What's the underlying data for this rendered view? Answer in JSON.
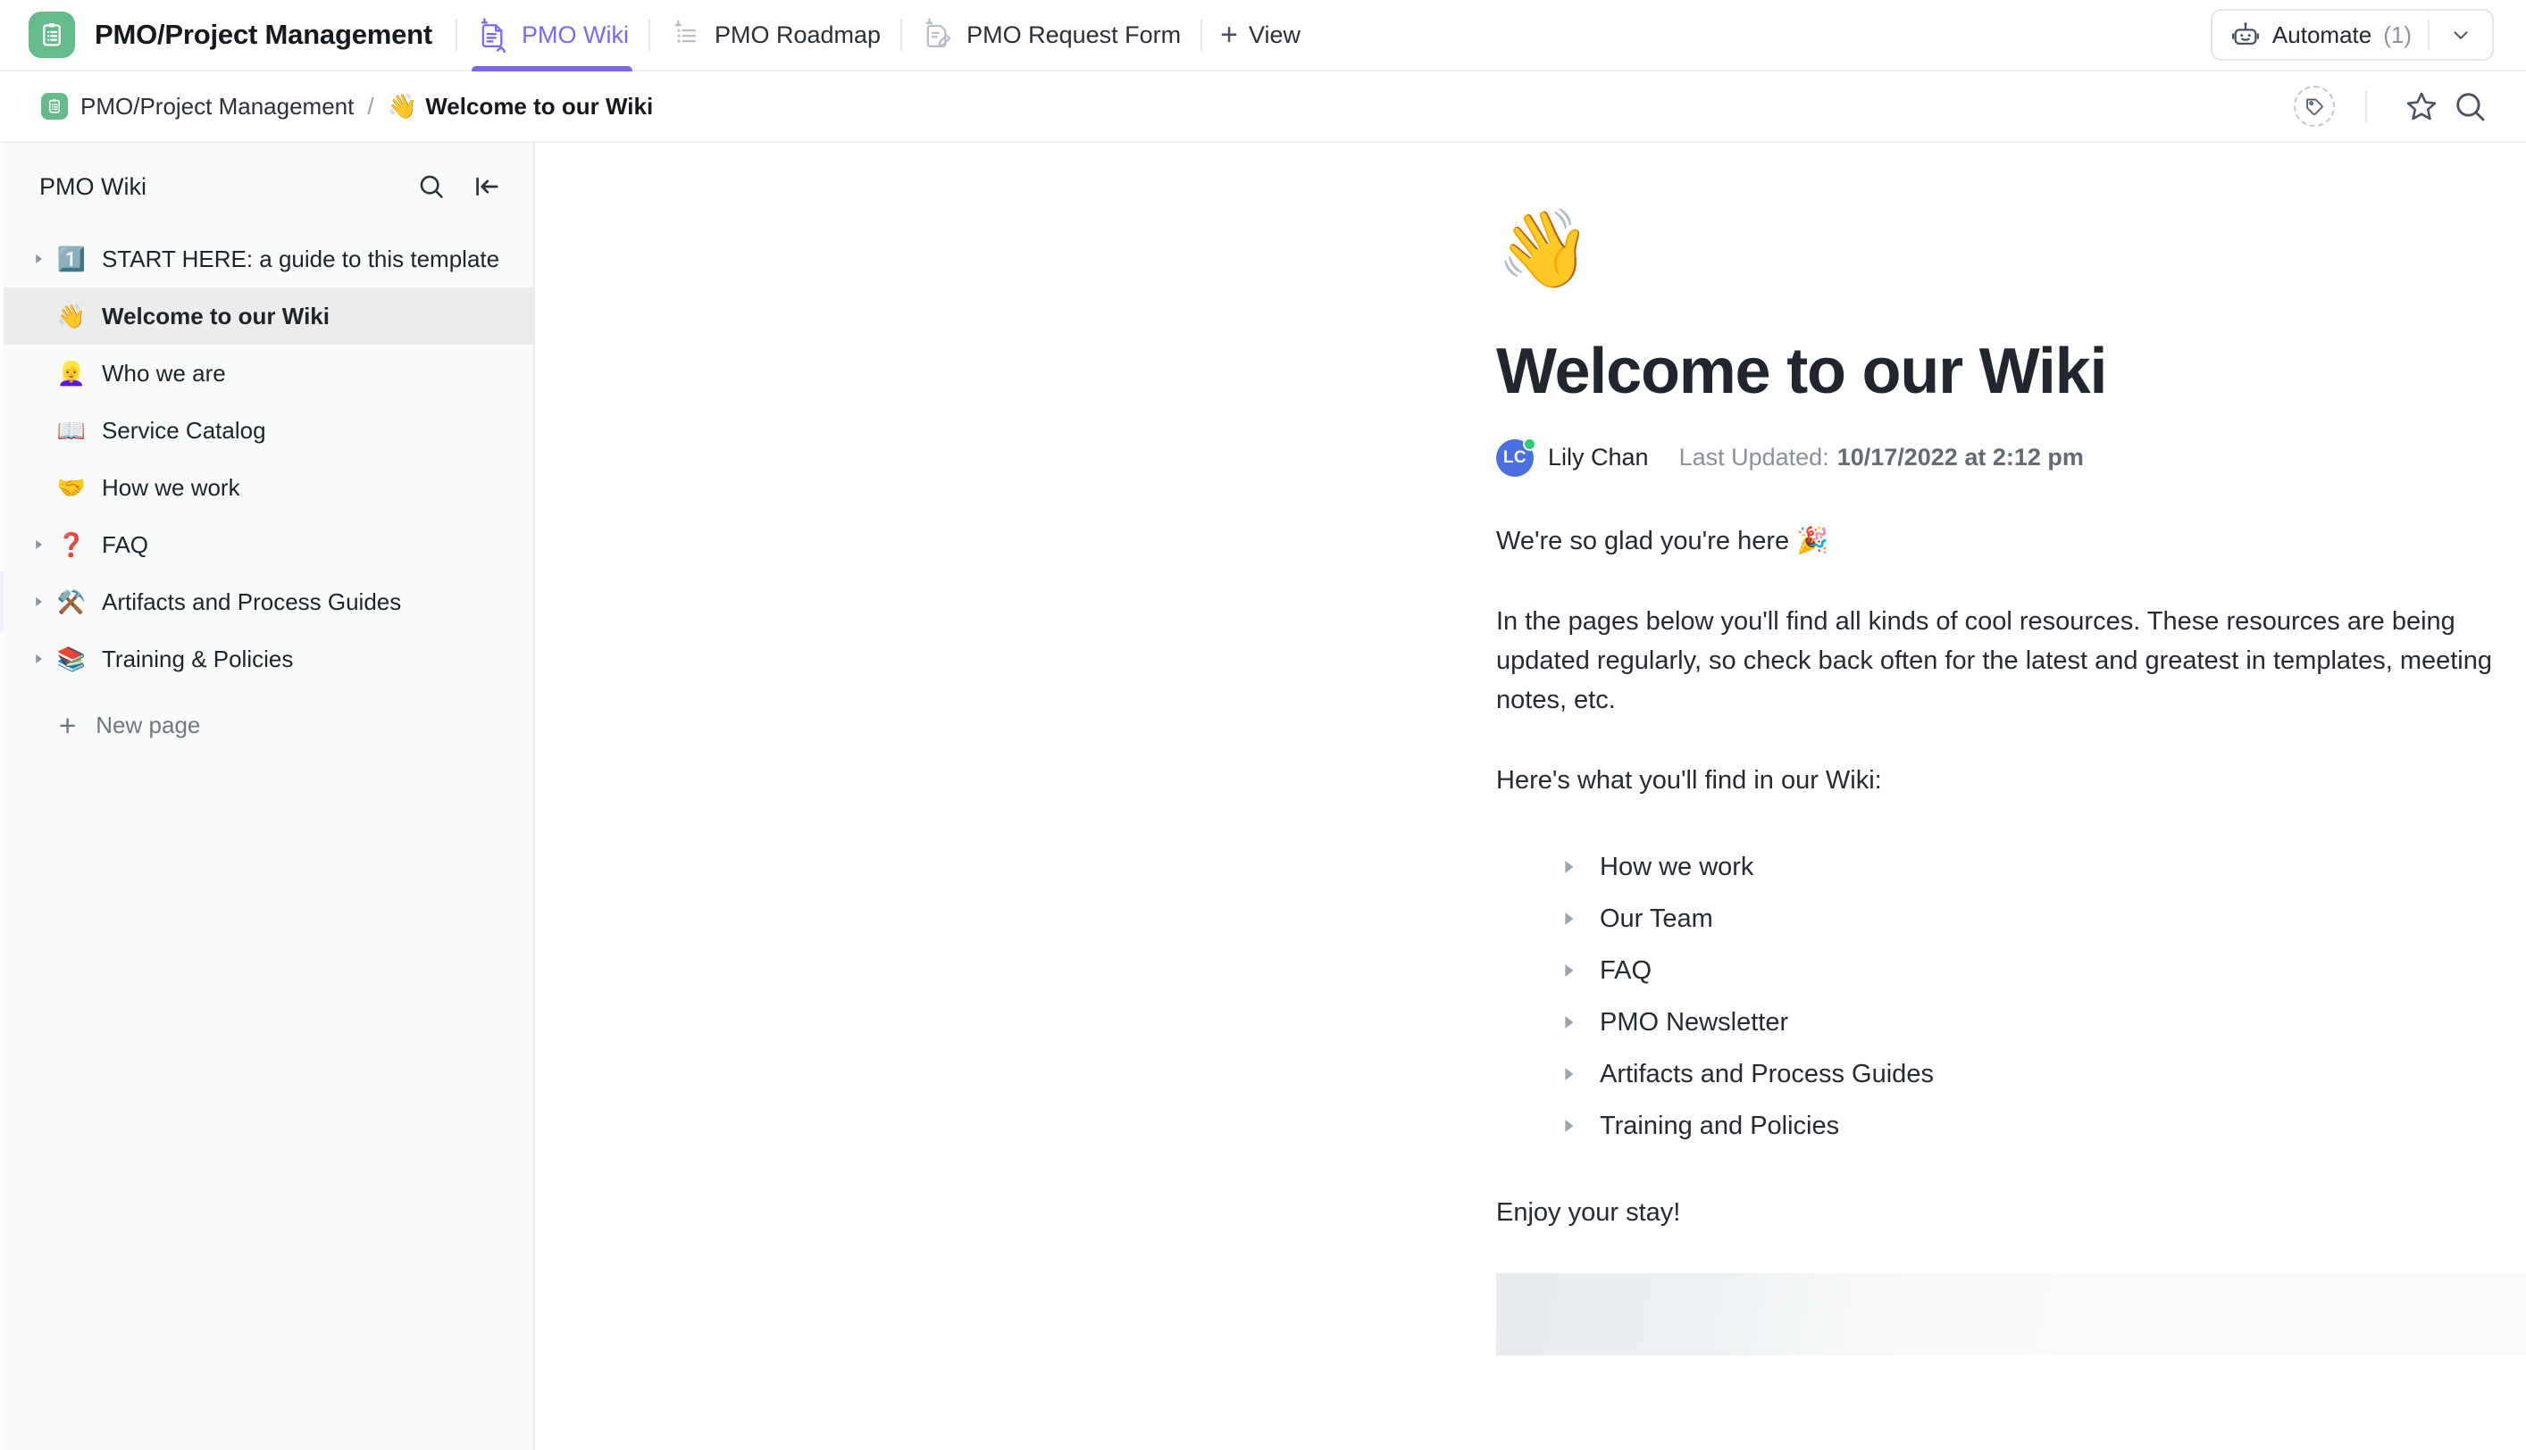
{
  "topbar": {
    "logo_icon": "clipboard-checklist-icon",
    "logo_color": "#66bb8a",
    "app_title": "PMO/Project Management",
    "tabs": [
      {
        "label": "PMO Wiki",
        "icon": "doc-home-pinned-icon",
        "active": true
      },
      {
        "label": "PMO Roadmap",
        "icon": "list-pinned-icon",
        "active": false
      },
      {
        "label": "PMO Request Form",
        "icon": "form-pinned-icon",
        "active": false
      }
    ],
    "add_view": {
      "label": "View",
      "icon": "plus-icon"
    },
    "automate": {
      "label": "Automate",
      "count": "(1)",
      "icon": "robot-icon",
      "caret_icon": "chevron-down-icon"
    },
    "accent_color": "#7b68ee"
  },
  "breadcrumb": {
    "space_label": "PMO/Project Management",
    "separator": "/",
    "current_emoji": "👋",
    "current_label": "Welcome to our Wiki",
    "actions": {
      "tag_icon": "tag-icon",
      "favorite_icon": "star-icon",
      "search_icon": "search-icon"
    }
  },
  "sidebar": {
    "title": "PMO Wiki",
    "search_icon": "search-icon",
    "collapse_icon": "collapse-sidebar-icon",
    "items": [
      {
        "emoji": "1️⃣",
        "label": "START HERE: a guide to this template",
        "expandable": true,
        "selected": false
      },
      {
        "emoji": "👋",
        "label": "Welcome to our Wiki",
        "expandable": false,
        "selected": true
      },
      {
        "emoji": "👱‍♀️",
        "label": "Who we are",
        "expandable": false,
        "selected": false
      },
      {
        "emoji": "📖",
        "label": "Service Catalog",
        "expandable": false,
        "selected": false
      },
      {
        "emoji": "🤝",
        "label": "How we work",
        "expandable": false,
        "selected": false
      },
      {
        "emoji": "❓",
        "label": "FAQ",
        "expandable": true,
        "selected": false
      },
      {
        "emoji": "⚒️",
        "label": "Artifacts and Process Guides",
        "expandable": true,
        "selected": false
      },
      {
        "emoji": "📚",
        "label": "Training & Policies",
        "expandable": true,
        "selected": false
      }
    ],
    "new_page_label": "New page",
    "selected_bg": "#ececec",
    "background": "#f9fafa"
  },
  "document": {
    "hero_emoji": "👋",
    "title": "Welcome to our Wiki",
    "author_initials": "LC",
    "author_name": "Lily Chan",
    "updated_label": "Last Updated:",
    "updated_value": "10/17/2022 at 2:12 pm",
    "paragraphs": [
      "We're so glad you're here 🎉",
      "In the pages below you'll find all kinds of cool resources. These resources are being updated regularly, so check back often for the latest and greatest in templates, meeting notes, etc.",
      "Here's what you'll find in our Wiki:"
    ],
    "bullets": [
      "How we work",
      "Our Team",
      "FAQ",
      "PMO Newsletter",
      "Artifacts and Process Guides",
      "Training and Policies"
    ],
    "closing": "Enjoy your stay!"
  }
}
